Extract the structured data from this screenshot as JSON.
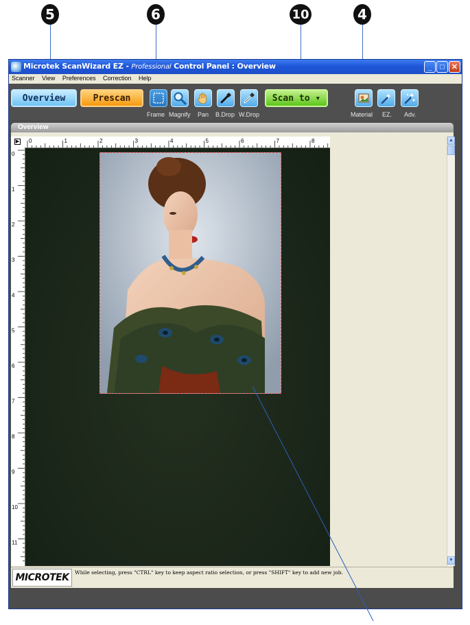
{
  "callouts": {
    "overview": "5",
    "tools": "6",
    "scan_to": "10",
    "settings": "4"
  },
  "window": {
    "title_app": "Microtek ScanWizard EZ - ",
    "title_edition": "Professional",
    "title_rest": " Control Panel : Overview",
    "minimize": "_",
    "maximize": "□",
    "close": "✕"
  },
  "menu": [
    "Scanner",
    "View",
    "Preferences",
    "Correction",
    "Help"
  ],
  "toolbar": {
    "overview_label": "Overview",
    "prescan_label": "Prescan",
    "scan_to_label": "Scan to ▾",
    "tools": [
      {
        "label": "Frame",
        "icon": "frame-icon"
      },
      {
        "label": "Magnify",
        "icon": "magnify-icon"
      },
      {
        "label": "Pan",
        "icon": "pan-hand-icon"
      },
      {
        "label": "B.Drop",
        "icon": "black-dropper-icon"
      },
      {
        "label": "W.Drop",
        "icon": "white-dropper-icon"
      }
    ],
    "right_tools": [
      {
        "label": "Material",
        "icon": "material-icon"
      },
      {
        "label": "EZ.",
        "icon": "ez-wand-icon"
      },
      {
        "label": "Adv.",
        "icon": "advanced-icon"
      }
    ]
  },
  "panel": {
    "header": "Overview",
    "ruler_h": [
      "0",
      "1",
      "2",
      "3",
      "4",
      "5",
      "6",
      "7",
      "8"
    ],
    "ruler_v": [
      "0",
      "1",
      "2",
      "3",
      "4",
      "5",
      "6",
      "7",
      "8",
      "9",
      "10",
      "11"
    ],
    "ruler_corner": "▶"
  },
  "status": {
    "logo": "MICROTEK",
    "message": "While selecting, press \"CTRL\" key to keep aspect ratio selection, or press \"SHIFT\" key to add new job."
  },
  "colors": {
    "titlebar": "#1f57d9",
    "toolbar": "#4f4f4f",
    "overview_button": "#6fc3f3",
    "prescan_button": "#f59a10",
    "scan_button": "#5cc51a",
    "scanbed": "#1a2519",
    "selection_border": "#ff5a5a"
  }
}
